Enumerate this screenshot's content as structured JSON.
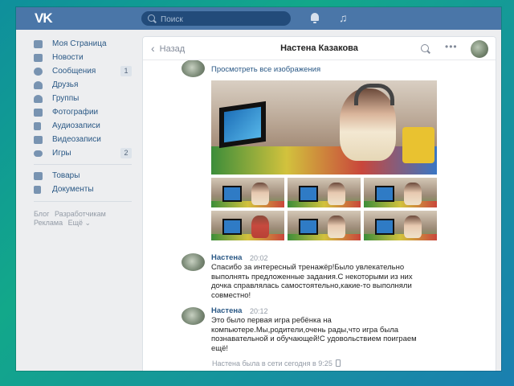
{
  "topbar": {
    "logo_text": "VK",
    "search_placeholder": "Поиск",
    "icons": [
      "vk-logo-icon",
      "bell-icon",
      "music-note-icon"
    ],
    "brand_color": "#4a76a8"
  },
  "sidebar": {
    "items": [
      {
        "label": "Моя Страница",
        "icon": "home-icon",
        "count": ""
      },
      {
        "label": "Новости",
        "icon": "news-icon",
        "count": ""
      },
      {
        "label": "Сообщения",
        "icon": "chat-bubble-icon",
        "count": "1"
      },
      {
        "label": "Друзья",
        "icon": "friend-icon",
        "count": ""
      },
      {
        "label": "Группы",
        "icon": "group-icon",
        "count": ""
      },
      {
        "label": "Фотографии",
        "icon": "camera-icon",
        "count": ""
      },
      {
        "label": "Аудиозаписи",
        "icon": "music-icon",
        "count": ""
      },
      {
        "label": "Видеозаписи",
        "icon": "video-icon",
        "count": ""
      },
      {
        "label": "Игры",
        "icon": "gamepad-icon",
        "count": "2"
      },
      {
        "label": "Товары",
        "icon": "bag-icon",
        "count": ""
      },
      {
        "label": "Документы",
        "icon": "document-icon",
        "count": ""
      }
    ],
    "footer_row1": [
      "Блог",
      "Разработчикам"
    ],
    "footer_row2": [
      "Реклама",
      "Ещё ⌄"
    ]
  },
  "chat": {
    "back_label": "Назад",
    "title": "Настена Казакова",
    "view_all_images": "Просмотреть все изображения",
    "messages": [
      {
        "author": "Настена",
        "time": "20:02",
        "text": "Спасибо за интересный тренажёр!Было увлекательно\nвыполнять предложенные задания.С некоторыми из них\nдочка справлялась самостоятельно,какие-то выполняли\nсовместно!"
      },
      {
        "author": "Настена",
        "time": "20:12",
        "text": "Это было первая игра ребёнка на\nкомпьютере.Мы,родители,очень рады,что игра была\nпознавательной и обучающей!С удовольствием поиграем\nещё!"
      }
    ],
    "status": "Настена была в сети сегодня в 9:25"
  }
}
